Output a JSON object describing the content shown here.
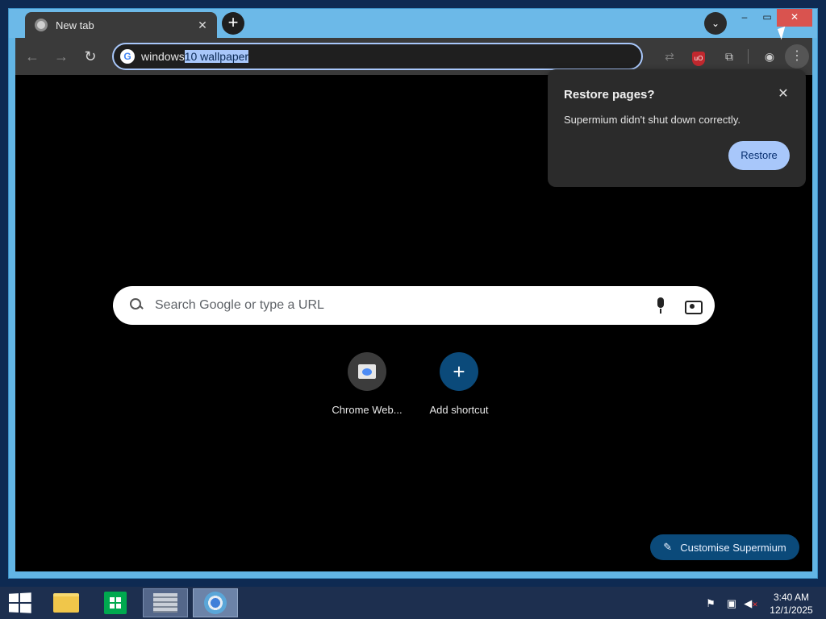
{
  "browser": {
    "tab": {
      "title": "New tab",
      "close_label": "✕"
    },
    "new_tab_label": "+",
    "window_controls": {
      "minimize": "–",
      "maximize": "▭",
      "close": "✕"
    },
    "omnibox": {
      "text_plain": "windows ",
      "text_selected": "10 wallpaper"
    }
  },
  "search": {
    "placeholder": "Search Google or type a URL"
  },
  "shortcuts": [
    {
      "label": "Chrome Web...",
      "icon": "web-store-icon"
    },
    {
      "label": "Add shortcut",
      "icon": "plus-icon",
      "glyph": "+"
    }
  ],
  "customise": {
    "label": "Customise Supermium"
  },
  "restore_popup": {
    "title": "Restore pages?",
    "message": "Supermium didn't shut down correctly.",
    "button": "Restore",
    "close": "✕"
  },
  "taskbar": {
    "items": [
      "start-button",
      "file-explorer",
      "windows-store",
      "server-manager",
      "supermium-browser"
    ]
  },
  "clock": {
    "time": "3:40 AM",
    "date": "12/1/2025"
  },
  "colors": {
    "accent_blue": "#a8c7fa",
    "window_frame": "#62b5e5",
    "customise_button": "#0b4a7a"
  }
}
